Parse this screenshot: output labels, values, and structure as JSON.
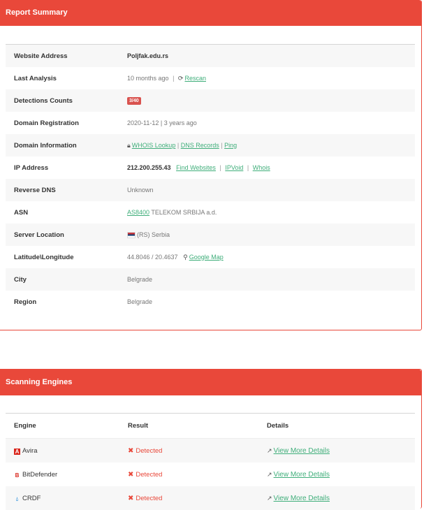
{
  "report": {
    "title": "Report Summary",
    "website_address": {
      "label": "Website Address",
      "value": "Poljfak.edu.rs"
    },
    "last_analysis": {
      "label": "Last Analysis",
      "value": "10 months ago",
      "rescan": "Rescan"
    },
    "detections": {
      "label": "Detections Counts",
      "value": "3/40"
    },
    "domain_registration": {
      "label": "Domain Registration",
      "value": "2020-11-12 | 3 years ago"
    },
    "domain_information": {
      "label": "Domain Information",
      "whois_lookup": "WHOIS Lookup",
      "dns_records": "DNS Records",
      "ping": "Ping"
    },
    "ip_address": {
      "label": "IP Address",
      "value": "212.200.255.43",
      "find_websites": "Find Websites",
      "ipvoid": "IPVoid",
      "whois": "Whois"
    },
    "reverse_dns": {
      "label": "Reverse DNS",
      "value": "Unknown"
    },
    "asn": {
      "label": "ASN",
      "asn_link": "AS8400",
      "value": "TELEKOM SRBIJA a.d."
    },
    "server_location": {
      "label": "Server Location",
      "value": "(RS) Serbia"
    },
    "lat_long": {
      "label": "Latitude\\Longitude",
      "value": "44.8046 / 20.4637",
      "map_link": "Google Map"
    },
    "city": {
      "label": "City",
      "value": "Belgrade"
    },
    "region": {
      "label": "Region",
      "value": "Belgrade"
    }
  },
  "engines": {
    "title": "Scanning Engines",
    "headers": {
      "engine": "Engine",
      "result": "Result",
      "details": "Details"
    },
    "rows": [
      {
        "name": "Avira",
        "result": "Detected",
        "details": "View More Details"
      },
      {
        "name": "BitDefender",
        "result": "Detected",
        "details": "View More Details"
      },
      {
        "name": "CRDF",
        "result": "Detected",
        "details": "View More Details"
      }
    ]
  },
  "colors": {
    "accent": "#e9483a",
    "link": "#3fae7a",
    "badge": "#d9534f"
  }
}
